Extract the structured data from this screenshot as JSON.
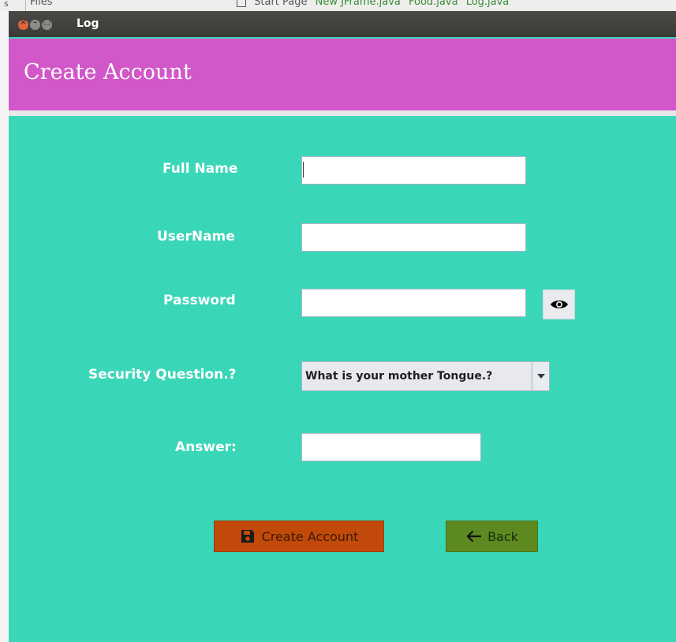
{
  "background_ide": {
    "left_label": "s",
    "files_label": "Files",
    "tabs": [
      "Start Page",
      "New JFrame.java",
      "Food.java",
      "Log.java"
    ]
  },
  "window": {
    "title": "Log",
    "controls": [
      "close-icon",
      "minimize-icon",
      "maximize-icon"
    ]
  },
  "header": {
    "title": "Create Account",
    "bg_color": "#d257c8"
  },
  "form": {
    "bg_color": "#3ad6b8",
    "full_name_label": "Full Name",
    "full_name_value": "",
    "username_label": "UserName",
    "username_value": "",
    "password_label": "Password",
    "password_value": "",
    "password_toggle_icon": "eye-icon",
    "security_label": "Security Question.?",
    "security_selected": "What is your mother Tongue.?",
    "answer_label": "Answer:",
    "answer_value": ""
  },
  "buttons": {
    "create_label": "Create Account",
    "create_icon": "save-icon",
    "create_color": "#c14909",
    "back_label": "Back",
    "back_icon": "arrow-left-icon",
    "back_color": "#5c8a20"
  }
}
